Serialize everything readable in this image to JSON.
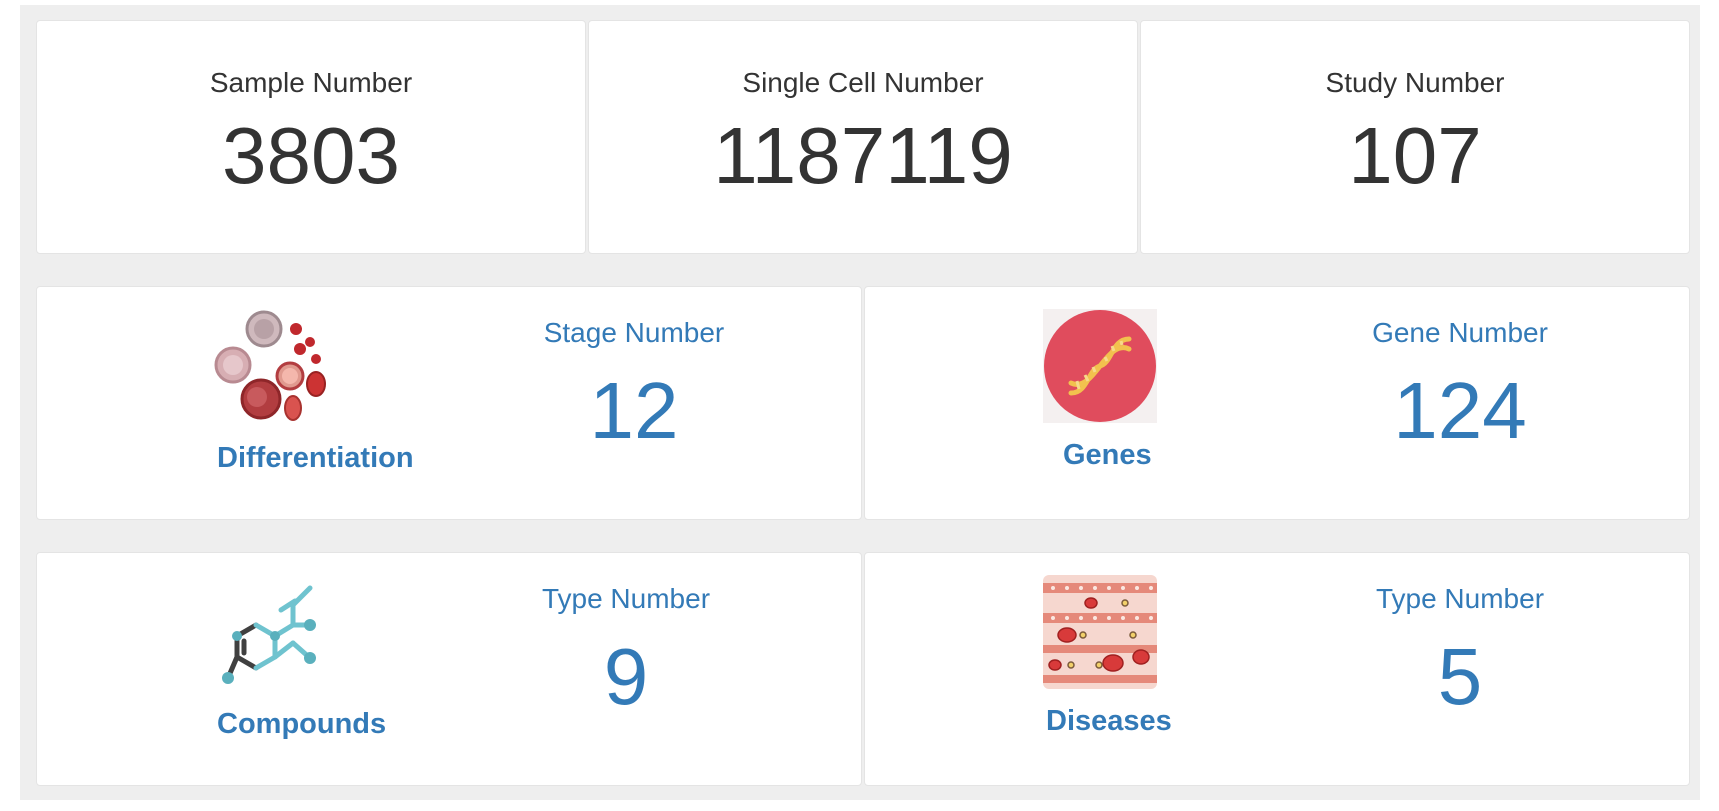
{
  "stats": [
    {
      "title": "Sample Number",
      "value": "3803"
    },
    {
      "title": "Single Cell Number",
      "value": "1187119"
    },
    {
      "title": "Study Number",
      "value": "107"
    }
  ],
  "features": {
    "differentiation": {
      "label": "Differentiation",
      "title": "Stage Number",
      "value": "12",
      "icon": "cells-icon"
    },
    "genes": {
      "label": "Genes",
      "title": "Gene Number",
      "value": "124",
      "icon": "dna-icon"
    },
    "compounds": {
      "label": "Compounds",
      "title": "Type Number",
      "value": "9",
      "icon": "molecule-icon"
    },
    "diseases": {
      "label": "Diseases",
      "title": "Type Number",
      "value": "5",
      "icon": "blood-vessel-icon"
    }
  },
  "colors": {
    "accent": "#337ab7",
    "text": "#333333",
    "background": "#eeeeee",
    "card": "#ffffff"
  }
}
